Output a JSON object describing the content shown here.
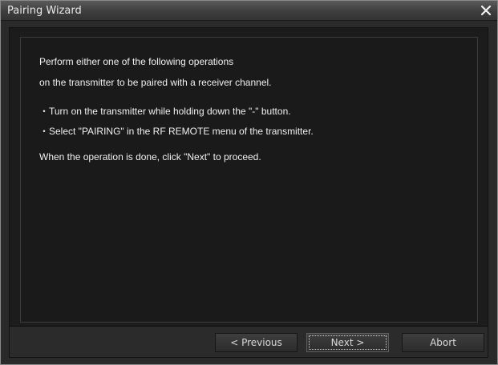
{
  "window": {
    "title": "Pairing Wizard"
  },
  "content": {
    "lines": [
      "Perform either one of the following operations",
      "on the transmitter to be paired with a receiver channel.",
      "・Turn on the transmitter while holding down the \"-\" button.",
      "・Select \"PAIRING\" in the RF REMOTE menu of the transmitter.",
      "When the operation is done, click \"Next\" to proceed."
    ]
  },
  "buttons": {
    "previous": "< Previous",
    "next": "Next >",
    "abort": "Abort"
  },
  "icons": {
    "close": "close-icon"
  },
  "colors": {
    "window_background": "#2a2a2a",
    "panel_background": "#1a1a1a",
    "text": "#f0f0f0"
  }
}
